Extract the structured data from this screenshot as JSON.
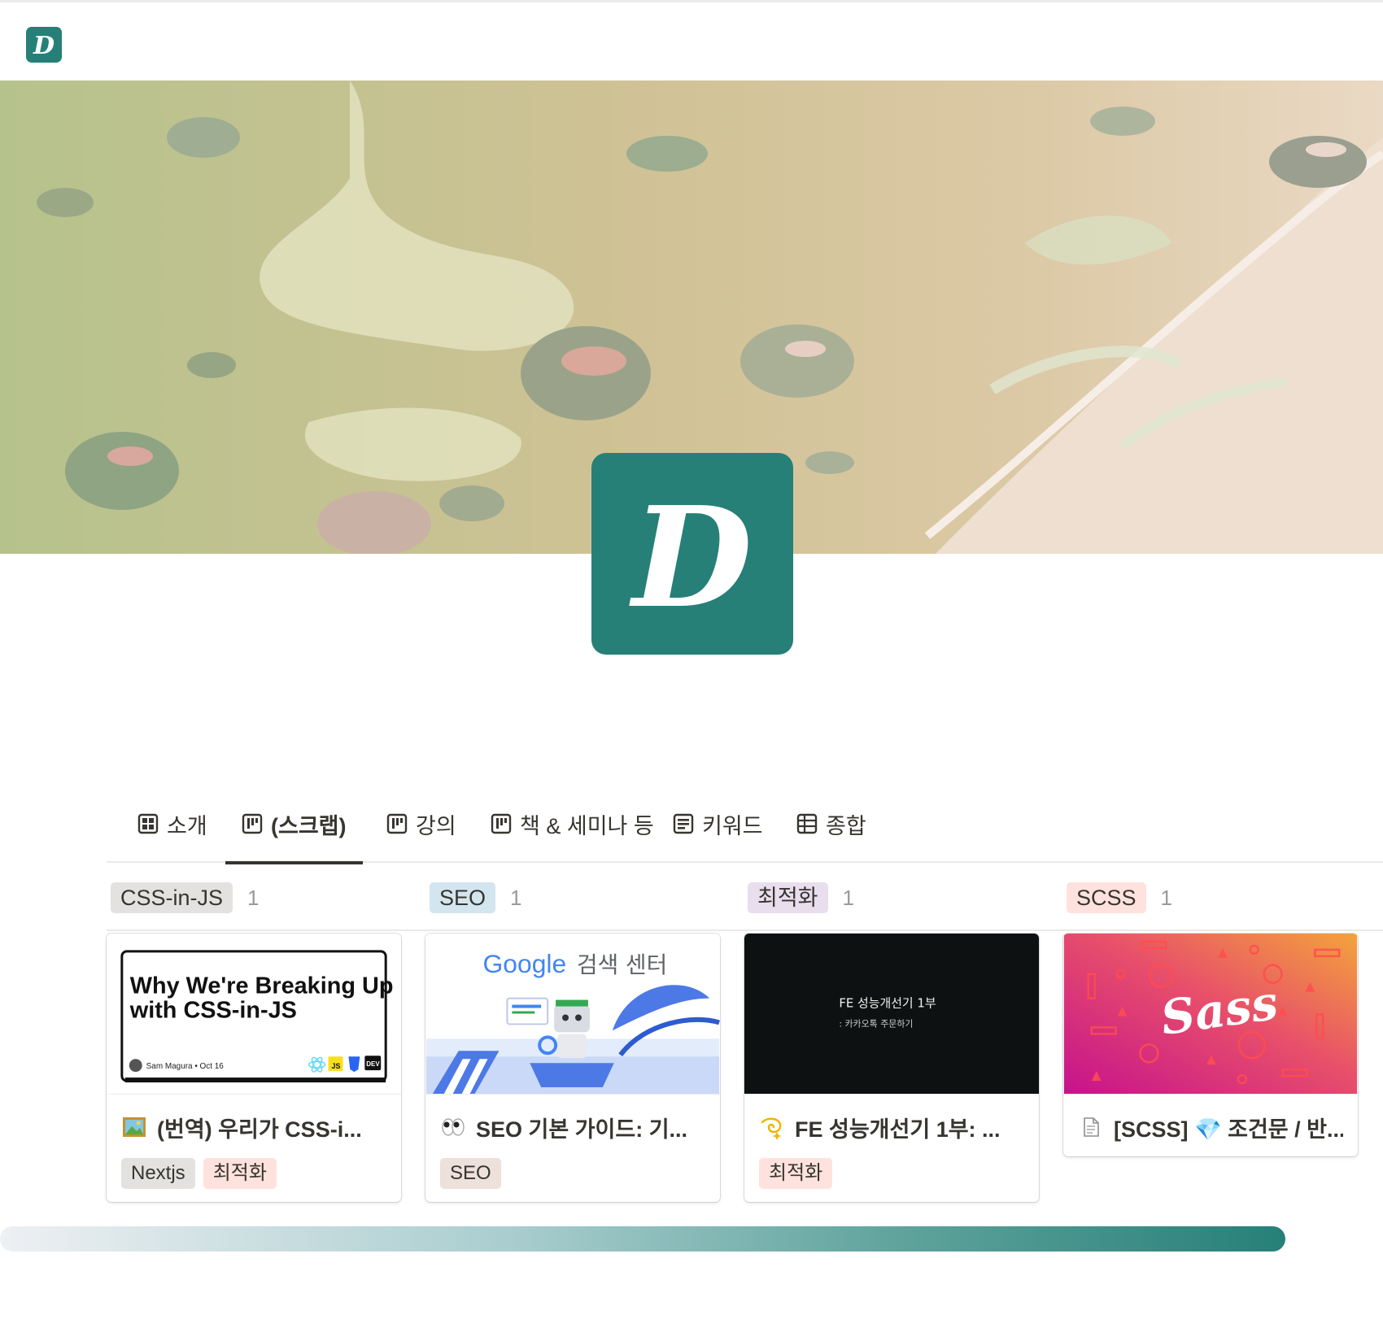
{
  "topbar": {
    "logo_letter": "D"
  },
  "page": {
    "icon_letter": "D",
    "brand_color": "#268078"
  },
  "tabs": [
    {
      "label": "소개",
      "icon": "grid-icon",
      "active": false
    },
    {
      "label": "(스크랩)",
      "icon": "board-icon",
      "active": true
    },
    {
      "label": "강의",
      "icon": "board-icon",
      "active": false
    },
    {
      "label": "책 & 세미나 등",
      "icon": "board-icon",
      "active": false
    },
    {
      "label": "키워드",
      "icon": "list-icon",
      "active": false
    },
    {
      "label": "종합",
      "icon": "table-icon",
      "active": false
    }
  ],
  "groups": [
    {
      "label": "CSS-in-JS",
      "count": "1",
      "color": "#e3e2e0"
    },
    {
      "label": "SEO",
      "count": "1",
      "color": "#d3e5ef"
    },
    {
      "label": "최적화",
      "count": "1",
      "color": "#e8deee"
    },
    {
      "label": "SCSS",
      "count": "1",
      "color": "#ffe2dd"
    }
  ],
  "cards": [
    {
      "title": "(번역) 우리가 CSS-i...",
      "emoji": "framed-picture-icon",
      "thumb": {
        "headline_1": "Why We're Breaking Up",
        "headline_2": "with CSS-in-JS",
        "author": "Sam Magura • Oct 16",
        "badge_js": "JS",
        "badge_dev": "DEV"
      },
      "tags": [
        {
          "label": "Nextjs",
          "color": "#e3e2e0"
        },
        {
          "label": "최적화",
          "color": "#ffe2dd"
        }
      ]
    },
    {
      "title": "SEO 기본 가이드: 기...",
      "emoji": "eyes-icon",
      "thumb": {
        "brand": "Google",
        "subtitle": "검색 센터"
      },
      "tags": [
        {
          "label": "SEO",
          "color": "#eee0da"
        }
      ]
    },
    {
      "title": "FE 성능개선기 1부: ...",
      "emoji": "dizzy-icon",
      "thumb": {
        "line_1": "FE 성능개선기 1부",
        "line_2": ": 카카오톡 주문하기"
      },
      "tags": [
        {
          "label": "최적화",
          "color": "#ffe2dd"
        }
      ]
    },
    {
      "title": "[SCSS] 💎 조건문 / 반...",
      "emoji": "page-icon",
      "thumb": {
        "brand": "Sass"
      },
      "tags": []
    }
  ],
  "progress": {
    "value": 0.93
  }
}
